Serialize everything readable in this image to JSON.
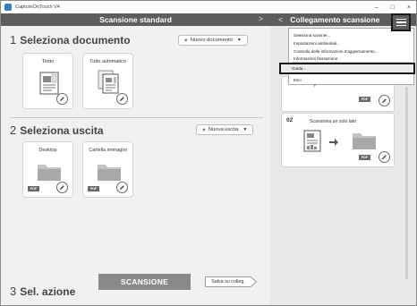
{
  "window": {
    "title": "CaptureOnTouch V4",
    "controls": {
      "minimize": "–",
      "maximize": "□",
      "close": "×"
    }
  },
  "left_panel": {
    "header": "Scansione standard",
    "header_chevron": ">",
    "step1": {
      "number": "1",
      "title": "Seleziona documento",
      "new_button": "Nuovo documento",
      "cards": [
        {
          "label": "Testo"
        },
        {
          "label": "Tutto automatico"
        }
      ]
    },
    "step2": {
      "number": "2",
      "title": "Seleziona uscita",
      "new_button": "Nuova uscita",
      "cards": [
        {
          "label": "Desktop",
          "badge": "PDF"
        },
        {
          "label": "Cartella immagini",
          "badge": "PDF"
        }
      ]
    },
    "step3": {
      "number": "3",
      "title": "Sel. azione",
      "scan_button": "SCANSIONE",
      "save_button": "Salva su colleg."
    }
  },
  "right_panel": {
    "header_chevron": "<",
    "header": "Collegamento scansione",
    "menu": {
      "items": [
        "Seleziona scanner...",
        "Impostazioni ambientali...",
        "Controlla delle informazioni d'aggiornamento...",
        "Informazioni flussazione"
      ],
      "highlighted": "Guida...",
      "last": "Esci"
    },
    "jobs": [
      {
        "number": "",
        "badge": "PDF"
      },
      {
        "number": "02",
        "description": "Scansiona un solo lato",
        "badge": "PDF"
      }
    ]
  },
  "colors": {
    "header_bg": "#5d5d5d",
    "scan_button_bg": "#8a8a8a",
    "folder_gray": "#bdbdbd",
    "badge_bg": "#6a6a6a"
  }
}
